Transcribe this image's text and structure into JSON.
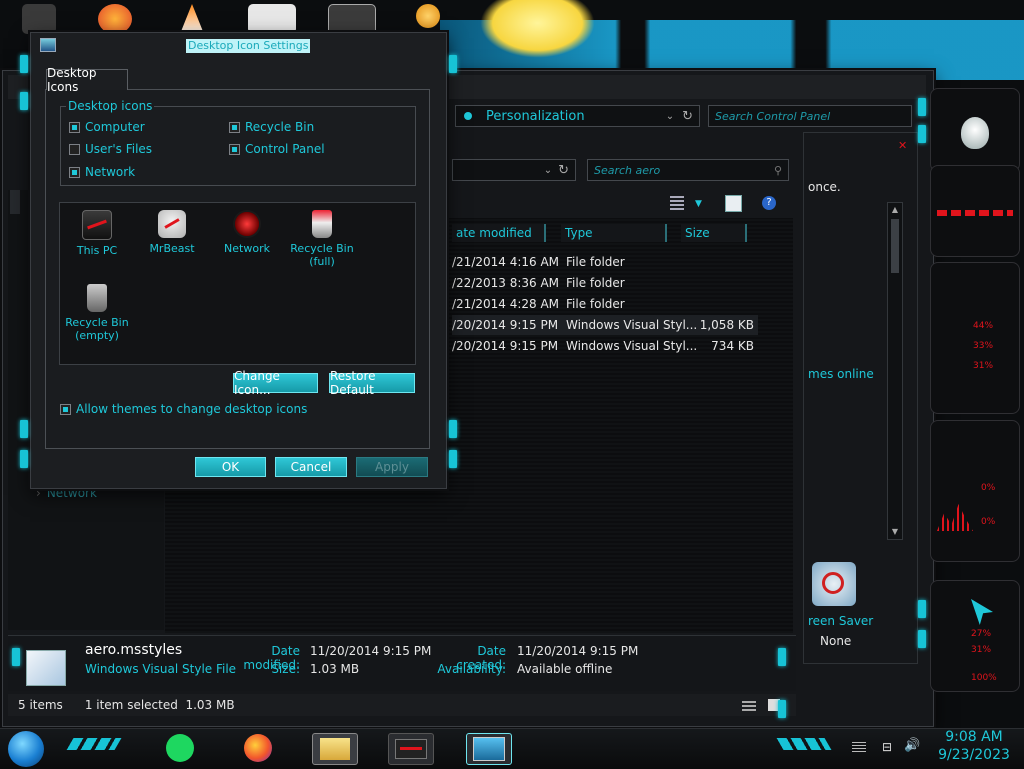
{
  "dialog": {
    "title": "Desktop Icon Settings",
    "tab": "Desktop Icons",
    "group_label": "Desktop icons",
    "checkboxes": [
      {
        "label": "Computer",
        "checked": true
      },
      {
        "label": "Recycle Bin",
        "checked": true
      },
      {
        "label": "User's Files",
        "checked": false
      },
      {
        "label": "Control Panel",
        "checked": true
      },
      {
        "label": "Network",
        "checked": true
      }
    ],
    "icons": [
      {
        "label": "This PC",
        "icon": "this-pc-icon"
      },
      {
        "label": "MrBeast",
        "icon": "user-files-icon"
      },
      {
        "label": "Network",
        "icon": "network-icon"
      },
      {
        "label": "Recycle Bin\n(full)",
        "icon": "recycle-bin-full-icon"
      },
      {
        "label": "Recycle Bin\n(empty)",
        "icon": "recycle-bin-empty-icon"
      }
    ],
    "change_icon": "Change Icon...",
    "restore_default": "Restore Default",
    "allow_themes": "Allow themes to change desktop icons",
    "allow_themes_checked": true,
    "ok": "OK",
    "cancel": "Cancel",
    "apply": "Apply"
  },
  "personalization": {
    "address": "Personalization",
    "search_placeholder": "Search Control Panel",
    "right_text_1": "once.",
    "right_text_2": "mes online",
    "screen_saver_label": "reen Saver",
    "screen_saver_value": "None"
  },
  "explorer": {
    "search_placeholder": "Search aero",
    "columns": [
      "ate modified",
      "Type",
      "Size"
    ],
    "rows": [
      {
        "date": "/21/2014 4:16 AM",
        "type": "File folder",
        "size": ""
      },
      {
        "date": "/22/2013 8:36 AM",
        "type": "File folder",
        "size": ""
      },
      {
        "date": "/21/2014 4:28 AM",
        "type": "File folder",
        "size": ""
      },
      {
        "date": "/20/2014 9:15 PM",
        "type": "Windows Visual Styl...",
        "size": "1,058 KB"
      },
      {
        "date": "/20/2014 9:15 PM",
        "type": "Windows Visual Styl...",
        "size": "734 KB"
      }
    ],
    "nav_network": "Network",
    "details": {
      "filename": "aero.msstyles",
      "filetype": "Windows Visual Style File",
      "date_modified_label": "Date modified:",
      "date_modified": "11/20/2014 9:15 PM",
      "size_label": "Size:",
      "size": "1.03 MB",
      "date_created_label": "Date created:",
      "date_created": "11/20/2014 9:15 PM",
      "availability_label": "Availability:",
      "availability": "Available offline"
    },
    "status_items": "5 items",
    "status_selected": "1 item selected  1.03 MB"
  },
  "gadgets": {
    "g1": "44%",
    "g2": "33%",
    "g3": "31%",
    "g4": "0%",
    "g5": "0%",
    "g6": "27%",
    "g7": "31%",
    "g8": "100%"
  },
  "clock": {
    "time": "9:08 AM",
    "date": "9/23/2023"
  },
  "colors": {
    "accent": "#1fc8d9",
    "alien_red": "#e0141c"
  }
}
